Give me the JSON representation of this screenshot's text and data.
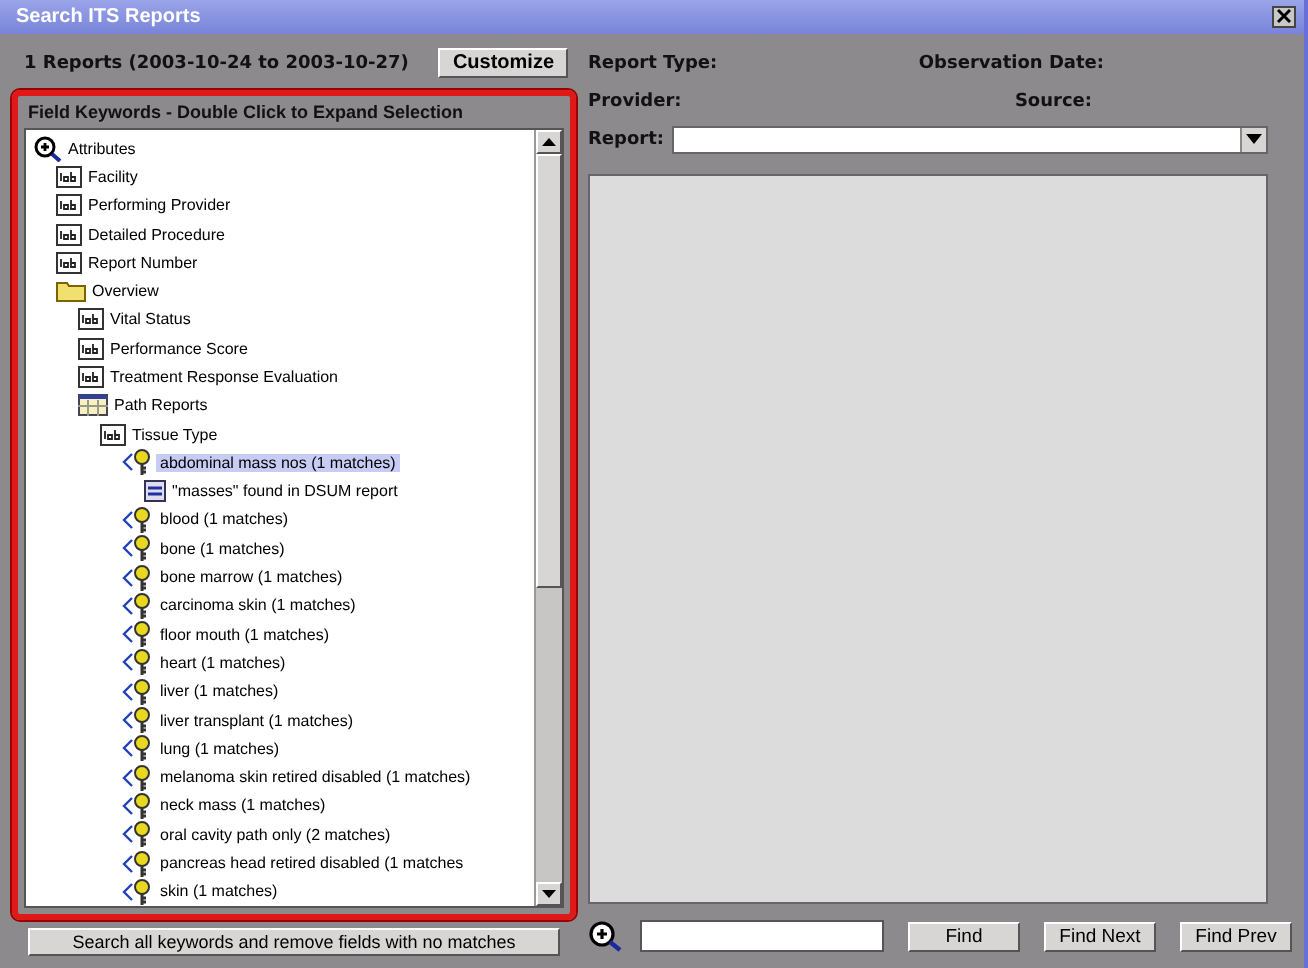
{
  "window": {
    "title": "Search ITS Reports"
  },
  "summary": "1 Reports  (2003-10-24  to  2003-10-27)",
  "customize_button": "Customize",
  "keywords_panel": {
    "title": "Field Keywords - Double Click to Expand Selection",
    "tree": {
      "label": "Attributes",
      "kind": "search",
      "selected": false,
      "children": [
        {
          "label": "Facility",
          "kind": "field",
          "selected": false
        },
        {
          "label": "Performing Provider",
          "kind": "field",
          "selected": false
        },
        {
          "label": "Detailed Procedure",
          "kind": "field",
          "selected": false
        },
        {
          "label": "Report Number",
          "kind": "field",
          "selected": false
        },
        {
          "label": "Overview",
          "kind": "folder",
          "selected": false,
          "children": [
            {
              "label": "Vital Status",
              "kind": "field",
              "selected": false
            },
            {
              "label": "Performance Score",
              "kind": "field",
              "selected": false
            },
            {
              "label": "Treatment Response Evaluation",
              "kind": "field",
              "selected": false
            },
            {
              "label": "Path Reports",
              "kind": "table",
              "selected": false,
              "children": [
                {
                  "label": "Tissue Type",
                  "kind": "field",
                  "selected": false,
                  "children": [
                    {
                      "label": "abdominal mass nos (1 matches)",
                      "kind": "match",
                      "selected": true,
                      "children": [
                        {
                          "label": "\"masses\" found in DSUM report",
                          "kind": "report",
                          "selected": false
                        }
                      ]
                    },
                    {
                      "label": "blood (1 matches)",
                      "kind": "match",
                      "selected": false
                    },
                    {
                      "label": "bone (1 matches)",
                      "kind": "match",
                      "selected": false
                    },
                    {
                      "label": "bone marrow (1 matches)",
                      "kind": "match",
                      "selected": false
                    },
                    {
                      "label": "carcinoma skin (1 matches)",
                      "kind": "match",
                      "selected": false
                    },
                    {
                      "label": "floor mouth (1 matches)",
                      "kind": "match",
                      "selected": false
                    },
                    {
                      "label": "heart (1 matches)",
                      "kind": "match",
                      "selected": false
                    },
                    {
                      "label": "liver (1 matches)",
                      "kind": "match",
                      "selected": false
                    },
                    {
                      "label": "liver transplant (1 matches)",
                      "kind": "match",
                      "selected": false
                    },
                    {
                      "label": "lung (1 matches)",
                      "kind": "match",
                      "selected": false
                    },
                    {
                      "label": "melanoma skin retired disabled (1 matches)",
                      "kind": "match",
                      "selected": false
                    },
                    {
                      "label": "neck mass (1 matches)",
                      "kind": "match",
                      "selected": false
                    },
                    {
                      "label": "oral cavity path only (2 matches)",
                      "kind": "match",
                      "selected": false
                    },
                    {
                      "label": "pancreas head retired disabled (1 matches",
                      "kind": "match",
                      "selected": false
                    },
                    {
                      "label": "skin (1 matches)",
                      "kind": "match",
                      "selected": false
                    }
                  ]
                }
              ]
            }
          ]
        }
      ]
    },
    "bottom_button": "Search all keywords and remove fields with no matches"
  },
  "details": {
    "report_type_label": "Report Type:",
    "observation_date_label": "Observation Date:",
    "provider_label": "Provider:",
    "source_label": "Source:",
    "report_label": "Report:"
  },
  "find_bar": {
    "buttons": [
      "Find",
      "Find Next",
      "Find Prev"
    ]
  }
}
